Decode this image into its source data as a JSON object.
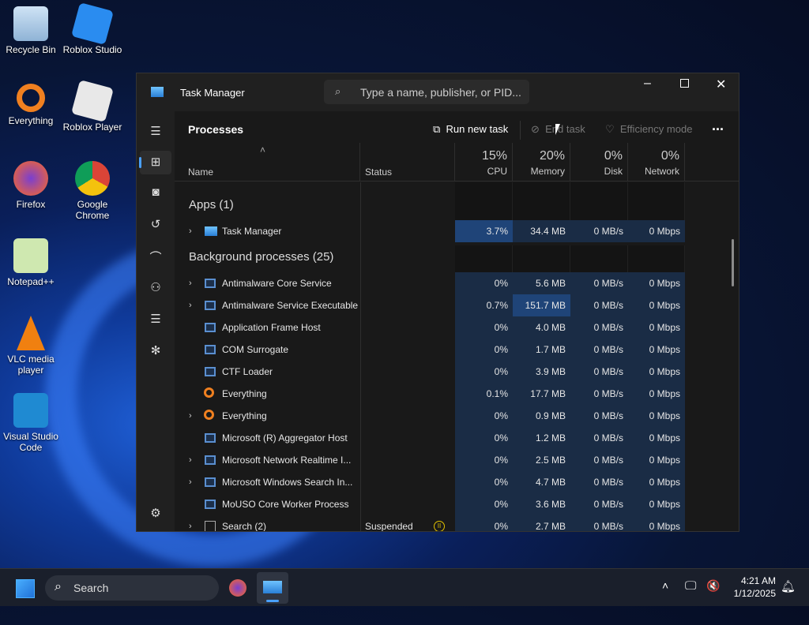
{
  "desktop": {
    "icons": [
      "Recycle Bin",
      "Roblox Studio",
      "Everything",
      "Roblox Player",
      "Firefox",
      "Google Chrome",
      "Notepad++",
      "VLC media player",
      "Visual Studio Code"
    ]
  },
  "window": {
    "title": "Task Manager",
    "search_placeholder": "Type a name, publisher, or PID..."
  },
  "toolbar": {
    "page": "Processes",
    "run_new_task": "Run new task",
    "end_task": "End task",
    "efficiency_mode": "Efficiency mode",
    "more": "..."
  },
  "columns": {
    "name": "Name",
    "status": "Status",
    "cpu_pct": "15%",
    "cpu": "CPU",
    "mem_pct": "20%",
    "mem": "Memory",
    "disk_pct": "0%",
    "disk": "Disk",
    "net_pct": "0%",
    "net": "Network"
  },
  "groups": {
    "apps": "Apps (1)",
    "background": "Background processes (25)"
  },
  "apps": [
    {
      "name": "Task Manager",
      "expand": true,
      "status": "",
      "cpu": "3.7%",
      "mem": "34.4 MB",
      "disk": "0 MB/s",
      "net": "0 Mbps",
      "icon": "task-manager"
    }
  ],
  "background": [
    {
      "name": "Antimalware Core Service",
      "expand": true,
      "status": "",
      "cpu": "0%",
      "mem": "5.6 MB",
      "disk": "0 MB/s",
      "net": "0 Mbps",
      "icon": "app"
    },
    {
      "name": "Antimalware Service Executable",
      "expand": true,
      "status": "",
      "cpu": "0.7%",
      "mem": "151.7 MB",
      "disk": "0 MB/s",
      "net": "0 Mbps",
      "icon": "app"
    },
    {
      "name": "Application Frame Host",
      "expand": false,
      "status": "",
      "cpu": "0%",
      "mem": "4.0 MB",
      "disk": "0 MB/s",
      "net": "0 Mbps",
      "icon": "app"
    },
    {
      "name": "COM Surrogate",
      "expand": false,
      "status": "",
      "cpu": "0%",
      "mem": "1.7 MB",
      "disk": "0 MB/s",
      "net": "0 Mbps",
      "icon": "app"
    },
    {
      "name": "CTF Loader",
      "expand": false,
      "status": "",
      "cpu": "0%",
      "mem": "3.9 MB",
      "disk": "0 MB/s",
      "net": "0 Mbps",
      "icon": "app"
    },
    {
      "name": "Everything",
      "expand": false,
      "status": "",
      "cpu": "0.1%",
      "mem": "17.7 MB",
      "disk": "0 MB/s",
      "net": "0 Mbps",
      "icon": "everything"
    },
    {
      "name": "Everything",
      "expand": true,
      "status": "",
      "cpu": "0%",
      "mem": "0.9 MB",
      "disk": "0 MB/s",
      "net": "0 Mbps",
      "icon": "everything"
    },
    {
      "name": "Microsoft (R) Aggregator Host",
      "expand": false,
      "status": "",
      "cpu": "0%",
      "mem": "1.2 MB",
      "disk": "0 MB/s",
      "net": "0 Mbps",
      "icon": "app"
    },
    {
      "name": "Microsoft Network Realtime I...",
      "expand": true,
      "status": "",
      "cpu": "0%",
      "mem": "2.5 MB",
      "disk": "0 MB/s",
      "net": "0 Mbps",
      "icon": "app"
    },
    {
      "name": "Microsoft Windows Search In...",
      "expand": true,
      "status": "",
      "cpu": "0%",
      "mem": "4.7 MB",
      "disk": "0 MB/s",
      "net": "0 Mbps",
      "icon": "search-indexer"
    },
    {
      "name": "MoUSO Core Worker Process",
      "expand": false,
      "status": "",
      "cpu": "0%",
      "mem": "3.6 MB",
      "disk": "0 MB/s",
      "net": "0 Mbps",
      "icon": "app"
    },
    {
      "name": "Search (2)",
      "expand": true,
      "status": "Suspended",
      "cpu": "0%",
      "mem": "2.7 MB",
      "disk": "0 MB/s",
      "net": "0 Mbps",
      "icon": "search"
    }
  ],
  "taskbar": {
    "search": "Search",
    "time": "4:21 AM",
    "date": "1/12/2025"
  },
  "colors": {
    "heat_low": "#1a2c45",
    "heat_mid": "#1f4478",
    "accent": "#4aa0ff"
  }
}
